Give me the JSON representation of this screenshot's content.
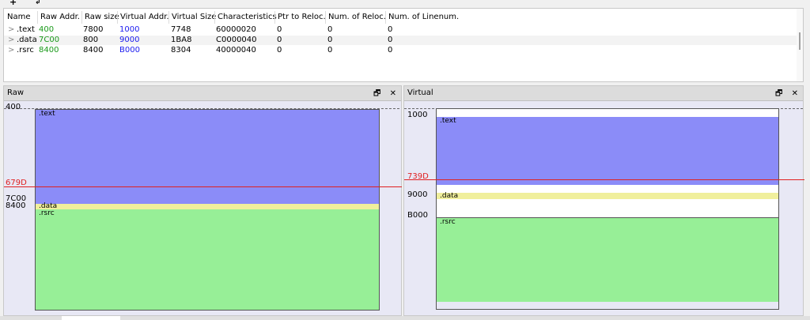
{
  "table": {
    "headers": [
      "Name",
      "Raw Addr.",
      "Raw size",
      "Virtual Addr.",
      "Virtual Size",
      "Characteristics",
      "Ptr to Reloc.",
      "Num. of Reloc.",
      "Num. of Linenum."
    ],
    "rows": [
      {
        "name": ".text",
        "raw_addr": "400",
        "raw_size": "7800",
        "virtual_addr": "1000",
        "virtual_size": "7748",
        "characteristics": "60000020",
        "ptr_reloc": "0",
        "num_reloc": "0",
        "num_linenum": "0"
      },
      {
        "name": ".data",
        "raw_addr": "7C00",
        "raw_size": "800",
        "virtual_addr": "9000",
        "virtual_size": "1BA8",
        "characteristics": "C0000040",
        "ptr_reloc": "0",
        "num_reloc": "0",
        "num_linenum": "0"
      },
      {
        "name": ".rsrc",
        "raw_addr": "8400",
        "raw_size": "8400",
        "virtual_addr": "B000",
        "virtual_size": "8304",
        "characteristics": "40000040",
        "ptr_reloc": "0",
        "num_reloc": "0",
        "num_linenum": "0"
      }
    ],
    "chevron": ">"
  },
  "raw_panel": {
    "title": "Raw",
    "addr_start": "400",
    "addr_marker": "679D",
    "addr_data": "7C00",
    "addr_rsrc": "8400",
    "sections": [
      ".text",
      ".data",
      ".rsrc"
    ]
  },
  "virtual_panel": {
    "title": "Virtual",
    "addr_start": "1000",
    "addr_marker": "739D",
    "addr_data": "9000",
    "addr_rsrc": "B000",
    "sections": [
      ".text",
      ".data",
      ".rsrc"
    ]
  },
  "panel_buttons": {
    "restore": "🗗",
    "close": "✕"
  },
  "toolbar": {
    "add": "+",
    "extra": "↲"
  },
  "colors": {
    "text_section": "#8b8cf8",
    "data_section": "#f0ef9c",
    "rsrc_section": "#97ef97",
    "marker": "#e02020"
  }
}
